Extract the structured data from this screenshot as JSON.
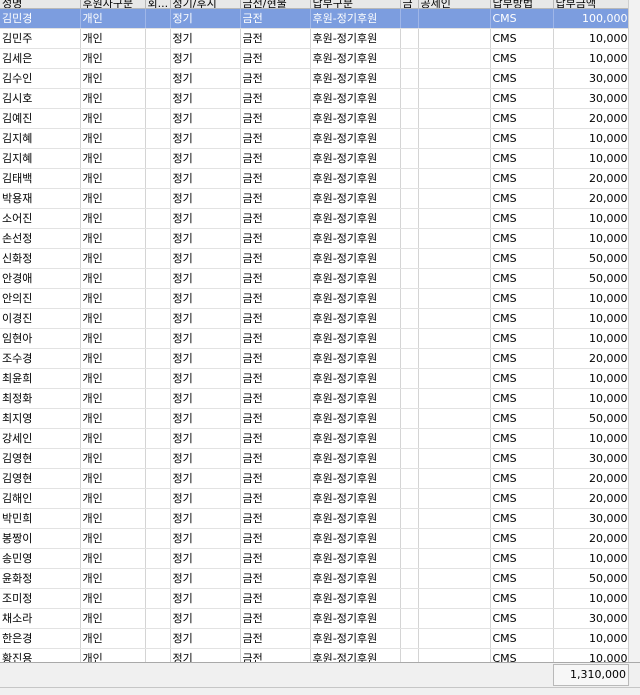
{
  "columns": [
    {
      "label": "성명"
    },
    {
      "label": "후원자구분"
    },
    {
      "label": "회..."
    },
    {
      "label": "정기/후시"
    },
    {
      "label": "금전/현물"
    },
    {
      "label": "납부구분"
    },
    {
      "label": "금"
    },
    {
      "label": "공제인"
    },
    {
      "label": "납부방법"
    },
    {
      "label": "납부금액"
    }
  ],
  "rows": [
    {
      "name": "김민경",
      "type": "개인",
      "member": "",
      "period": "정기",
      "kind": "금전",
      "category": "후원-정기후원",
      "g": "",
      "h": "",
      "method": "CMS",
      "amount": "100,000",
      "selected": true
    },
    {
      "name": "김민주",
      "type": "개인",
      "member": "",
      "period": "정기",
      "kind": "금전",
      "category": "후원-정기후원",
      "g": "",
      "h": "",
      "method": "CMS",
      "amount": "10,000"
    },
    {
      "name": "김세은",
      "type": "개인",
      "member": "",
      "period": "정기",
      "kind": "금전",
      "category": "후원-정기후원",
      "g": "",
      "h": "",
      "method": "CMS",
      "amount": "10,000"
    },
    {
      "name": "김수인",
      "type": "개인",
      "member": "",
      "period": "정기",
      "kind": "금전",
      "category": "후원-정기후원",
      "g": "",
      "h": "",
      "method": "CMS",
      "amount": "30,000"
    },
    {
      "name": "김시호",
      "type": "개인",
      "member": "",
      "period": "정기",
      "kind": "금전",
      "category": "후원-정기후원",
      "g": "",
      "h": "",
      "method": "CMS",
      "amount": "30,000"
    },
    {
      "name": "김예진",
      "type": "개인",
      "member": "",
      "period": "정기",
      "kind": "금전",
      "category": "후원-정기후원",
      "g": "",
      "h": "",
      "method": "CMS",
      "amount": "20,000"
    },
    {
      "name": "김지혜",
      "type": "개인",
      "member": "",
      "period": "정기",
      "kind": "금전",
      "category": "후원-정기후원",
      "g": "",
      "h": "",
      "method": "CMS",
      "amount": "10,000"
    },
    {
      "name": "김지혜",
      "type": "개인",
      "member": "",
      "period": "정기",
      "kind": "금전",
      "category": "후원-정기후원",
      "g": "",
      "h": "",
      "method": "CMS",
      "amount": "10,000"
    },
    {
      "name": "김태백",
      "type": "개인",
      "member": "",
      "period": "정기",
      "kind": "금전",
      "category": "후원-정기후원",
      "g": "",
      "h": "",
      "method": "CMS",
      "amount": "20,000"
    },
    {
      "name": "박용재",
      "type": "개인",
      "member": "",
      "period": "정기",
      "kind": "금전",
      "category": "후원-정기후원",
      "g": "",
      "h": "",
      "method": "CMS",
      "amount": "20,000"
    },
    {
      "name": "소어진",
      "type": "개인",
      "member": "",
      "period": "정기",
      "kind": "금전",
      "category": "후원-정기후원",
      "g": "",
      "h": "",
      "method": "CMS",
      "amount": "10,000"
    },
    {
      "name": "손선정",
      "type": "개인",
      "member": "",
      "period": "정기",
      "kind": "금전",
      "category": "후원-정기후원",
      "g": "",
      "h": "",
      "method": "CMS",
      "amount": "10,000"
    },
    {
      "name": "신화정",
      "type": "개인",
      "member": "",
      "period": "정기",
      "kind": "금전",
      "category": "후원-정기후원",
      "g": "",
      "h": "",
      "method": "CMS",
      "amount": "50,000"
    },
    {
      "name": "안경애",
      "type": "개인",
      "member": "",
      "period": "정기",
      "kind": "금전",
      "category": "후원-정기후원",
      "g": "",
      "h": "",
      "method": "CMS",
      "amount": "50,000"
    },
    {
      "name": "안의진",
      "type": "개인",
      "member": "",
      "period": "정기",
      "kind": "금전",
      "category": "후원-정기후원",
      "g": "",
      "h": "",
      "method": "CMS",
      "amount": "10,000"
    },
    {
      "name": "이경진",
      "type": "개인",
      "member": "",
      "period": "정기",
      "kind": "금전",
      "category": "후원-정기후원",
      "g": "",
      "h": "",
      "method": "CMS",
      "amount": "10,000"
    },
    {
      "name": "임현아",
      "type": "개인",
      "member": "",
      "period": "정기",
      "kind": "금전",
      "category": "후원-정기후원",
      "g": "",
      "h": "",
      "method": "CMS",
      "amount": "10,000"
    },
    {
      "name": "조수경",
      "type": "개인",
      "member": "",
      "period": "정기",
      "kind": "금전",
      "category": "후원-정기후원",
      "g": "",
      "h": "",
      "method": "CMS",
      "amount": "20,000"
    },
    {
      "name": "최윤희",
      "type": "개인",
      "member": "",
      "period": "정기",
      "kind": "금전",
      "category": "후원-정기후원",
      "g": "",
      "h": "",
      "method": "CMS",
      "amount": "10,000"
    },
    {
      "name": "최정화",
      "type": "개인",
      "member": "",
      "period": "정기",
      "kind": "금전",
      "category": "후원-정기후원",
      "g": "",
      "h": "",
      "method": "CMS",
      "amount": "10,000"
    },
    {
      "name": "최지영",
      "type": "개인",
      "member": "",
      "period": "정기",
      "kind": "금전",
      "category": "후원-정기후원",
      "g": "",
      "h": "",
      "method": "CMS",
      "amount": "50,000"
    },
    {
      "name": "강세인",
      "type": "개인",
      "member": "",
      "period": "정기",
      "kind": "금전",
      "category": "후원-정기후원",
      "g": "",
      "h": "",
      "method": "CMS",
      "amount": "10,000"
    },
    {
      "name": "김영현",
      "type": "개인",
      "member": "",
      "period": "정기",
      "kind": "금전",
      "category": "후원-정기후원",
      "g": "",
      "h": "",
      "method": "CMS",
      "amount": "30,000"
    },
    {
      "name": "김영현",
      "type": "개인",
      "member": "",
      "period": "정기",
      "kind": "금전",
      "category": "후원-정기후원",
      "g": "",
      "h": "",
      "method": "CMS",
      "amount": "20,000"
    },
    {
      "name": "김해인",
      "type": "개인",
      "member": "",
      "period": "정기",
      "kind": "금전",
      "category": "후원-정기후원",
      "g": "",
      "h": "",
      "method": "CMS",
      "amount": "20,000"
    },
    {
      "name": "박민희",
      "type": "개인",
      "member": "",
      "period": "정기",
      "kind": "금전",
      "category": "후원-정기후원",
      "g": "",
      "h": "",
      "method": "CMS",
      "amount": "30,000"
    },
    {
      "name": "봉짱이",
      "type": "개인",
      "member": "",
      "period": "정기",
      "kind": "금전",
      "category": "후원-정기후원",
      "g": "",
      "h": "",
      "method": "CMS",
      "amount": "20,000"
    },
    {
      "name": "송민영",
      "type": "개인",
      "member": "",
      "period": "정기",
      "kind": "금전",
      "category": "후원-정기후원",
      "g": "",
      "h": "",
      "method": "CMS",
      "amount": "10,000"
    },
    {
      "name": "윤화정",
      "type": "개인",
      "member": "",
      "period": "정기",
      "kind": "금전",
      "category": "후원-정기후원",
      "g": "",
      "h": "",
      "method": "CMS",
      "amount": "50,000"
    },
    {
      "name": "조미정",
      "type": "개인",
      "member": "",
      "period": "정기",
      "kind": "금전",
      "category": "후원-정기후원",
      "g": "",
      "h": "",
      "method": "CMS",
      "amount": "10,000"
    },
    {
      "name": "채소라",
      "type": "개인",
      "member": "",
      "period": "정기",
      "kind": "금전",
      "category": "후원-정기후원",
      "g": "",
      "h": "",
      "method": "CMS",
      "amount": "30,000"
    },
    {
      "name": "한은경",
      "type": "개인",
      "member": "",
      "period": "정기",
      "kind": "금전",
      "category": "후원-정기후원",
      "g": "",
      "h": "",
      "method": "CMS",
      "amount": "10,000"
    },
    {
      "name": "황진용",
      "type": "개인",
      "member": "",
      "period": "정기",
      "kind": "금전",
      "category": "후원-정기후원",
      "g": "",
      "h": "",
      "method": "CMS",
      "amount": "10,000"
    }
  ],
  "footer": {
    "total": "1,310,000"
  }
}
